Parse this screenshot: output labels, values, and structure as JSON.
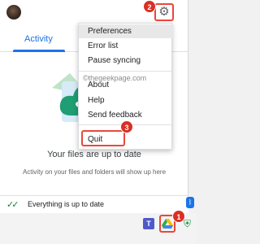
{
  "header": {
    "avatar_icon": "user-avatar",
    "settings_icon": "gear-icon"
  },
  "tabs": {
    "activity": "Activity"
  },
  "main": {
    "status_title": "Your files are up to date",
    "status_subtitle": "Activity on your files and folders will show up here"
  },
  "footer": {
    "status": "Everything is up to date"
  },
  "menu": {
    "items": [
      "Preferences",
      "Error list",
      "Pause syncing",
      "About",
      "Help",
      "Send feedback",
      "Quit"
    ],
    "highlighted": "Preferences"
  },
  "watermark": "©thegeekpage.com",
  "callouts": {
    "one": "1",
    "two": "2",
    "three": "3"
  },
  "taskbar": {
    "teams_label": "T"
  },
  "colors": {
    "accent": "#1a73e8",
    "callout": "#d93025",
    "drive_green": "#34a853",
    "drive_yellow": "#fbbc04",
    "drive_blue": "#4285f4"
  }
}
